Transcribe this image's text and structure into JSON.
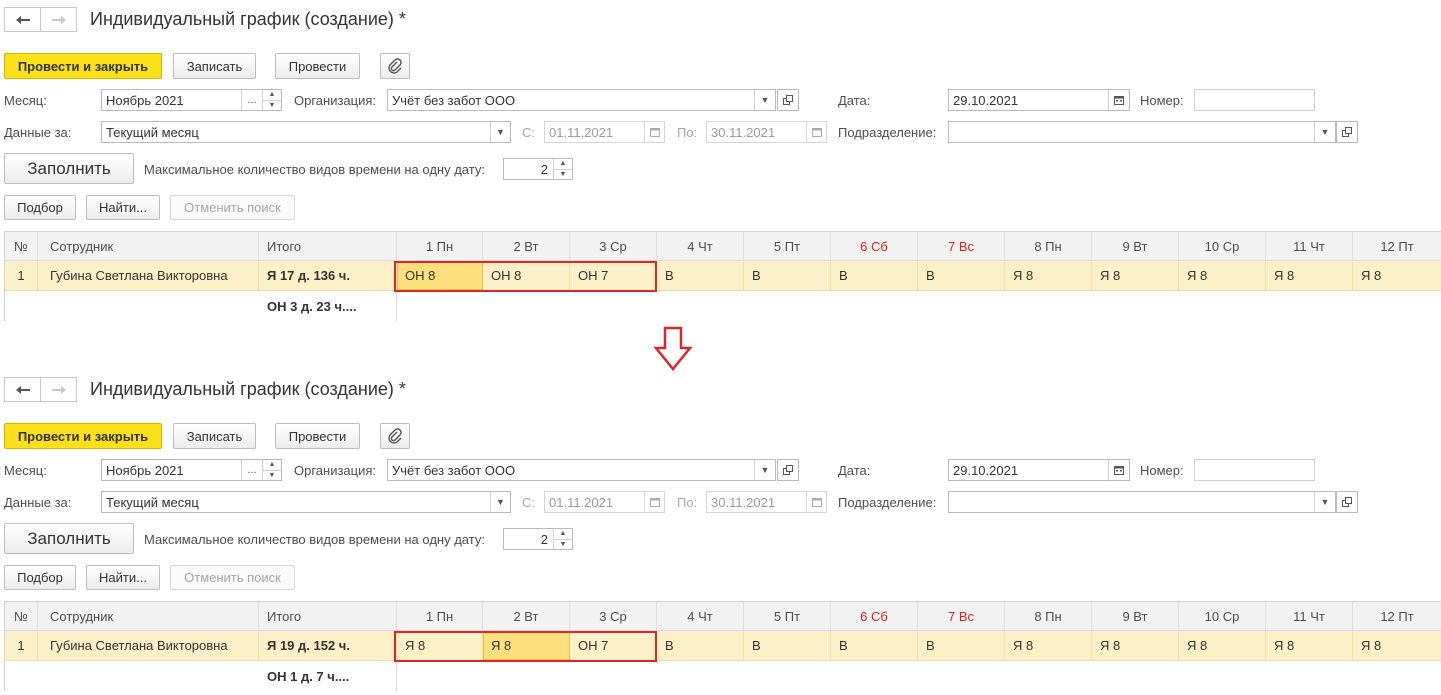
{
  "common": {
    "title": "Индивидуальный график (создание) *",
    "toolbar": {
      "post_close": "Провести и закрыть",
      "save": "Записать",
      "post": "Провести"
    },
    "fields": {
      "month_label": "Месяц:",
      "month_value": "Ноябрь 2021",
      "month_btn": "...",
      "org_label": "Организация:",
      "org_value": "Учёт без забот ООО",
      "date_label": "Дата:",
      "date_value": "29.10.2021",
      "number_label": "Номер:",
      "number_value": "",
      "data_for_label": "Данные за:",
      "data_for_value": "Текущий месяц",
      "from_label": "С:",
      "from_value": "01.11.2021",
      "to_label": "По:",
      "to_value": "30.11.2021",
      "dept_label": "Подразделение:",
      "dept_value": ""
    },
    "fill_button": "Заполнить",
    "max_types_label": "Максимальное количество видов времени на одну дату:",
    "max_types_value": "2",
    "list_toolbar": {
      "select": "Подбор",
      "find": "Найти...",
      "cancel_search": "Отменить поиск"
    },
    "columns": {
      "num": "№",
      "employee": "Сотрудник",
      "total": "Итого",
      "days": [
        "1 Пн",
        "2 Вт",
        "3 Ср",
        "4 Чт",
        "5 Пт",
        "6 Сб",
        "7 Вс",
        "8 Пн",
        "9 Вт",
        "10 Ср",
        "11 Чт",
        "12 Пт"
      ],
      "weekend_days": [
        5,
        6
      ]
    },
    "colors": {
      "primary_button": "#fce01a",
      "row_highlight": "#fbf0c7",
      "selected_cell": "#fde07d",
      "weekend_header": "#d9221c",
      "callout_box": "#d9272e"
    }
  },
  "before": {
    "row": {
      "num": "1",
      "employee": "Губина Светлана Викторовна",
      "total": "Я 17 д. 136 ч.",
      "total2": "ОН 3 д. 23 ч....",
      "days": [
        "ОН 8",
        "ОН 8",
        "ОН 7",
        "В",
        "В",
        "В",
        "В",
        "Я 8",
        "Я 8",
        "Я 8",
        "Я 8",
        "Я 8"
      ],
      "selected_day": 0
    }
  },
  "after": {
    "row": {
      "num": "1",
      "employee": "Губина Светлана Викторовна",
      "total": "Я 19 д. 152 ч.",
      "total2": "ОН 1 д. 7 ч....",
      "days": [
        "Я 8",
        "Я 8",
        "ОН 7",
        "В",
        "В",
        "В",
        "В",
        "Я 8",
        "Я 8",
        "Я 8",
        "Я 8",
        "Я 8"
      ],
      "selected_day": 1
    }
  },
  "transition_icon": "down-arrow-icon"
}
